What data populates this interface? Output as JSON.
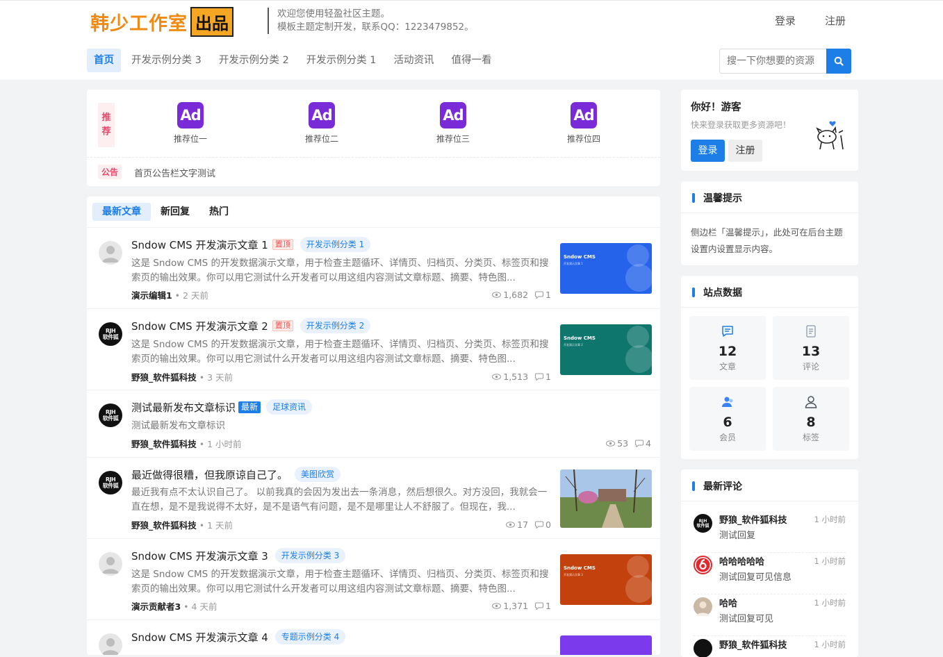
{
  "header": {
    "logo_text": "韩少工作室",
    "logo_box": "出品",
    "welcome_line1": "欢迎您使用轻盈社区主题。",
    "welcome_line2": "模板主题定制开发，联系QQ：1223479852。",
    "login": "登录",
    "register": "注册",
    "search_placeholder": "搜一下你想要的资源"
  },
  "nav": [
    "首页",
    "开发示例分类 3",
    "开发示例分类 2",
    "开发示例分类 1",
    "活动资讯",
    "值得一看"
  ],
  "recommend": {
    "tag": "推荐",
    "ad_text": "Ad",
    "items": [
      "推荐位一",
      "推荐位二",
      "推荐位三",
      "推荐位四"
    ],
    "notice_tag": "公告",
    "notice_text": "首页公告栏文字测试"
  },
  "tabs": [
    "最新文章",
    "新回复",
    "热门"
  ],
  "posts": [
    {
      "title": "Sndow CMS 开发演示文章 1",
      "top_badge": "置顶",
      "category": "开发示例分类 1",
      "excerpt": "这是 Sndow CMS 的开发数据演示文章，用于检查主题循环、详情页、归档页、分类页、标签页和搜索页的输出效果。你可以用它测试什么开发者可以用这组内容测试文章标题、摘要、特色图...",
      "author": "演示编辑1",
      "time": "2 天前",
      "views": "1,682",
      "comments": "1",
      "thumb_color": "#2563eb",
      "thumb_title": "Sndow CMS",
      "thumb_sub": "开发演示文章 1"
    },
    {
      "title": "Sndow CMS 开发演示文章 2",
      "top_badge": "置顶",
      "category": "开发示例分类 2",
      "excerpt": "这是 Sndow CMS 的开发数据演示文章，用于检查主题循环、详情页、归档页、分类页、标签页和搜索页的输出效果。你可以用它测试什么开发者可以用这组内容测试文章标题、摘要、特色图...",
      "author": "野狼_软件狐科技",
      "time": "3 天前",
      "views": "1,513",
      "comments": "1",
      "thumb_color": "#0f766e",
      "thumb_title": "Sndow CMS",
      "thumb_sub": "开发演示文章 2"
    },
    {
      "title": "测试最新发布文章标识",
      "new_badge": "最新",
      "category": "足球资讯",
      "excerpt": "测试最新发布文章标识",
      "author": "野狼_软件狐科技",
      "time": "1 小时前",
      "views": "53",
      "comments": "4"
    },
    {
      "title": "最近做得很糟，但我原谅自己了。",
      "category": "美图欣赏",
      "excerpt": "最近我有点不太认识自己了。 以前我真的会因为发出去一条消息，然后想很久。对方没回，我就会一直在想，是不是我说得不太好，是不是语气有问题，是不是哪里让人不舒服了。但现在，我...",
      "author": "野狼_软件狐科技",
      "time": "1 天前",
      "views": "17",
      "comments": "0"
    },
    {
      "title": "Sndow CMS 开发演示文章 3",
      "category": "开发示例分类 3",
      "excerpt": "这是 Sndow CMS 的开发数据演示文章，用于检查主题循环、详情页、归档页、分类页、标签页和搜索页的输出效果。你可以用它测试什么开发者可以用这组内容测试文章标题、摘要、特色图...",
      "author": "演示贡献者3",
      "time": "4 天前",
      "views": "1,371",
      "comments": "1",
      "thumb_color": "#c2410c",
      "thumb_title": "Sndow CMS",
      "thumb_sub": "开发演示文章 3"
    },
    {
      "title": "Sndow CMS 开发演示文章 4",
      "category": "专题示例分类 4",
      "thumb_color": "#7c3aed"
    }
  ],
  "sidebar": {
    "hello_title": "你好！游客",
    "hello_sub": "快来登录获取更多资源吧！",
    "login": "登录",
    "register": "注册",
    "tip_title": "温馨提示",
    "tip_text": "侧边栏「温馨提示」，此处可在后台主题设置内设置显示内容。",
    "stats_title": "站点数据",
    "stats": [
      {
        "num": "12",
        "label": "文章",
        "icon": "article-icon"
      },
      {
        "num": "13",
        "label": "评论",
        "icon": "comment-doc-icon"
      },
      {
        "num": "6",
        "label": "会员",
        "icon": "member-icon"
      },
      {
        "num": "8",
        "label": "标签",
        "icon": "user-tag-icon"
      }
    ],
    "comments_title": "最新评论",
    "comments": [
      {
        "name": "野狼_软件狐科技",
        "time": "1 小时前",
        "text": "测试回复"
      },
      {
        "name": "哈哈哈哈哈",
        "time": "1 小时前",
        "text": "测试回复可见信息"
      },
      {
        "name": "哈哈",
        "time": "1 小时前",
        "text": "测试回复可见"
      },
      {
        "name": "野狼_软件狐科技",
        "time": "1 小时前",
        "text": ""
      }
    ]
  },
  "colors": {
    "accent": "#1c7ee6",
    "notice": "#e6486b",
    "ad_purple": "#7a2bd8"
  }
}
